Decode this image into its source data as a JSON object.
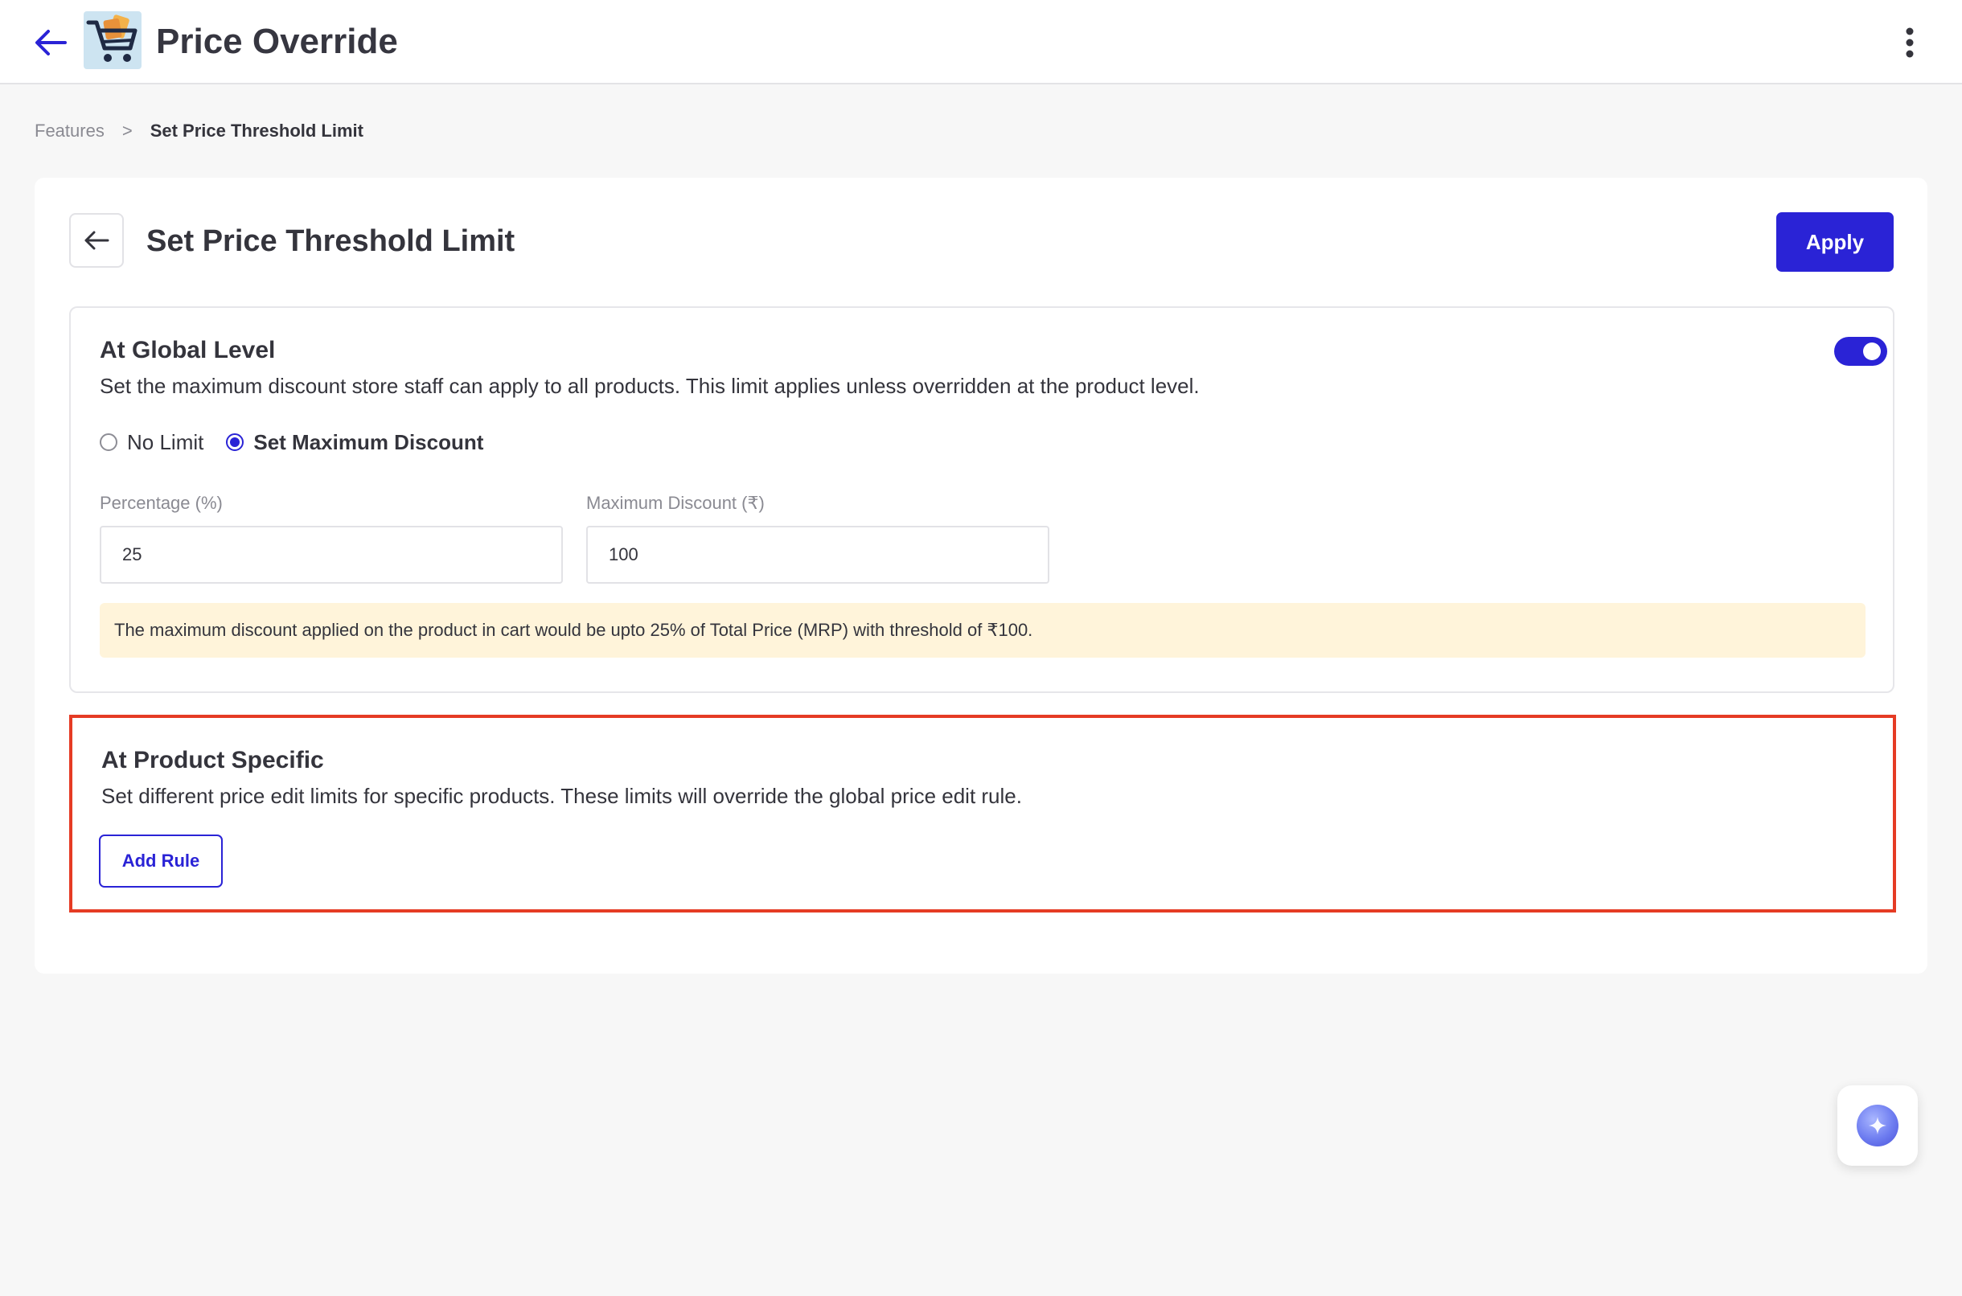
{
  "header": {
    "title": "Price Override",
    "back_icon": "arrow-left-icon",
    "logo_icon": "shopping-cart-logo",
    "menu_icon": "kebab-menu-icon"
  },
  "breadcrumb": {
    "parent": "Features",
    "separator": ">",
    "current": "Set Price Threshold Limit"
  },
  "card": {
    "title": "Set Price Threshold Limit",
    "apply_label": "Apply"
  },
  "global_level": {
    "title": "At Global Level",
    "description": "Set the maximum discount store staff can apply to all products. This limit applies unless overridden at the product level.",
    "enabled": true,
    "options": [
      {
        "label": "No Limit",
        "selected": false
      },
      {
        "label": "Set Maximum Discount",
        "selected": true
      }
    ],
    "percentage": {
      "label": "Percentage (%)",
      "value": "25"
    },
    "max_discount": {
      "label": "Maximum Discount (₹)",
      "value": "100"
    },
    "info_text": "The maximum discount applied on the product in cart would be upto 25% of Total Price (MRP) with threshold of ₹100."
  },
  "product_specific": {
    "title": "At Product Specific",
    "description": "Set different price edit limits for specific products. These limits will override the global price edit rule.",
    "add_rule_label": "Add Rule"
  },
  "colors": {
    "primary": "#2a23d6",
    "highlight_border": "#e53b24",
    "info_background": "#fff4da"
  },
  "assistant": {
    "icon": "sparkle-assistant-icon"
  }
}
